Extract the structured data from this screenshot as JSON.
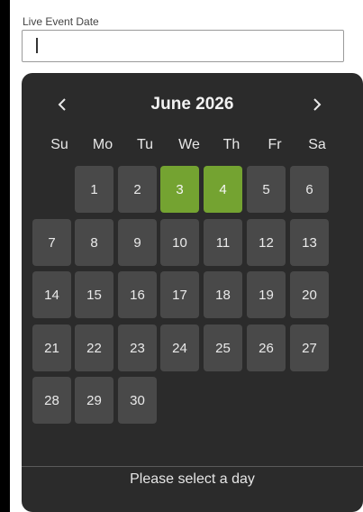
{
  "field": {
    "label": "Live Event Date",
    "value": ""
  },
  "calendar": {
    "month_title": "June 2026",
    "prev_label": "previous month",
    "next_label": "next month",
    "weekdays": [
      "Su",
      "Mo",
      "Tu",
      "We",
      "Th",
      "Fr",
      "Sa"
    ],
    "days": [
      "1",
      "2",
      "3",
      "4",
      "5",
      "6",
      "7",
      "8",
      "9",
      "10",
      "11",
      "12",
      "13",
      "14",
      "15",
      "16",
      "17",
      "18",
      "19",
      "20",
      "21",
      "22",
      "23",
      "24",
      "25",
      "26",
      "27",
      "28",
      "29",
      "30"
    ],
    "first_day_column": 1,
    "selected_days": [
      3,
      4
    ],
    "status_text": "Please select a day",
    "colors": {
      "background": "#2b2b2b",
      "day_tile": "#494949",
      "selected": "#74a331"
    }
  }
}
